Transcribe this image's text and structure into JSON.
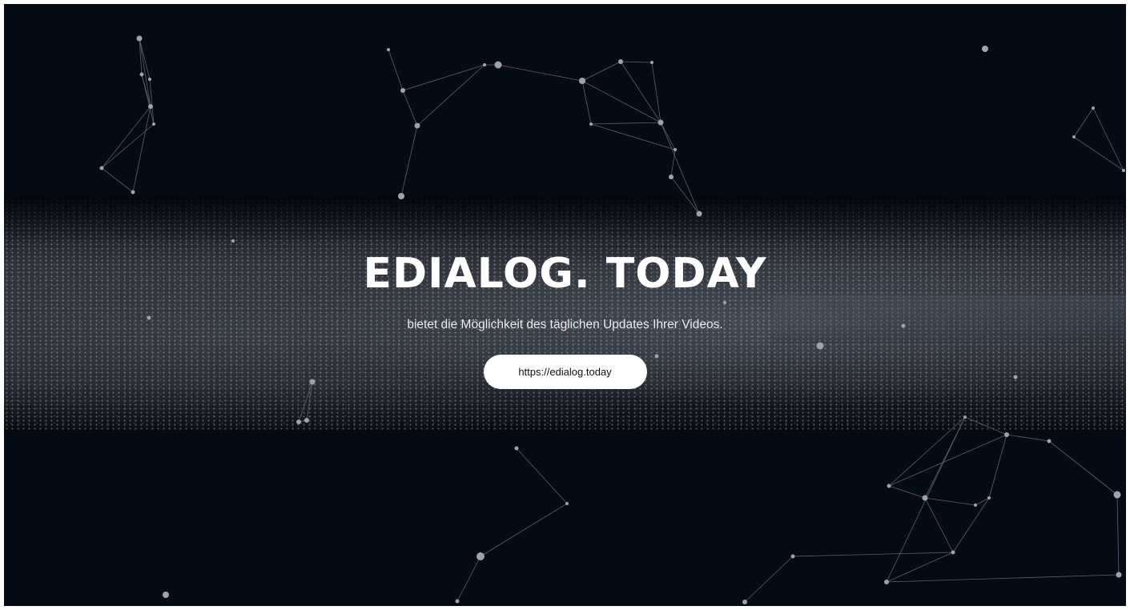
{
  "hero": {
    "title": "EDIALOG. TODAY",
    "subtitle": "bietet die Möglichkeit des täglichen Updates Ihrer Videos.",
    "link_label": "https://edialog.today"
  },
  "colors": {
    "background": "#060a13",
    "accent": "#ffffff",
    "node": "#9ea3ab",
    "edge": "#5a5f68"
  }
}
